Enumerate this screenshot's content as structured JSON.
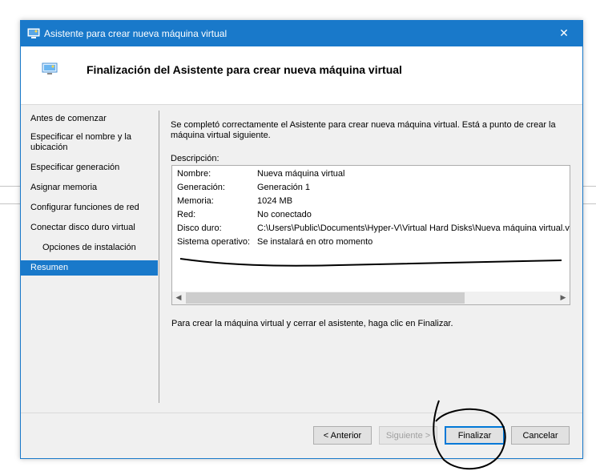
{
  "window": {
    "title": "Asistente para crear nueva máquina virtual",
    "close_glyph": "✕"
  },
  "header": {
    "title": "Finalización del Asistente para crear nueva máquina virtual"
  },
  "nav": {
    "items": [
      {
        "label": "Antes de comenzar"
      },
      {
        "label": "Especificar el nombre y la ubicación"
      },
      {
        "label": "Especificar generación"
      },
      {
        "label": "Asignar memoria"
      },
      {
        "label": "Configurar funciones de red"
      },
      {
        "label": "Conectar disco duro virtual"
      },
      {
        "label": "Opciones de instalación"
      },
      {
        "label": "Resumen"
      }
    ],
    "selected": "Resumen"
  },
  "content": {
    "intro": "Se completó correctamente el Asistente para crear nueva máquina virtual. Está a punto de crear la máquina virtual siguiente.",
    "description_label": "Descripción:",
    "summary": [
      {
        "key": "Nombre:",
        "value": "Nueva máquina virtual"
      },
      {
        "key": "Generación:",
        "value": "Generación 1"
      },
      {
        "key": "Memoria:",
        "value": "1024 MB"
      },
      {
        "key": "Red:",
        "value": "No conectado"
      },
      {
        "key": "Disco duro:",
        "value": "C:\\Users\\Public\\Documents\\Hyper-V\\Virtual Hard Disks\\Nueva máquina virtual.vhdx"
      },
      {
        "key": "Sistema operativo:",
        "value": "Se instalará en otro momento"
      }
    ],
    "footer_text": "Para crear la máquina virtual y cerrar el asistente, haga clic en Finalizar."
  },
  "buttons": {
    "previous": "< Anterior",
    "next": "Siguiente >",
    "finish": "Finalizar",
    "cancel": "Cancelar"
  },
  "colors": {
    "accent": "#1979ca",
    "annotation_ink": "#000000"
  }
}
